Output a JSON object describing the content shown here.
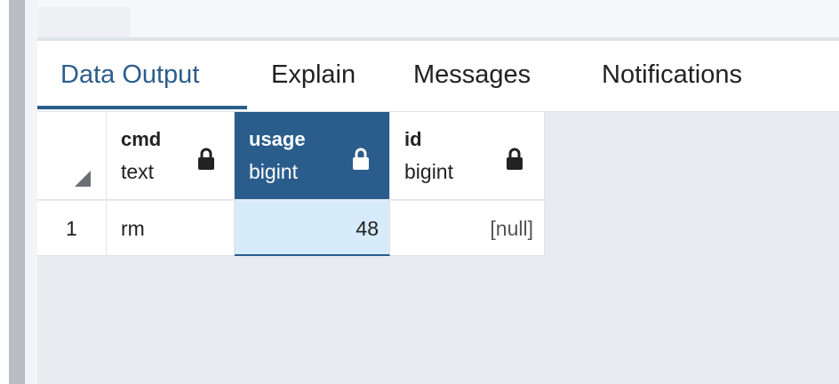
{
  "tabs": [
    {
      "label": "Data Output",
      "active": true
    },
    {
      "label": "Explain",
      "active": false
    },
    {
      "label": "Messages",
      "active": false
    },
    {
      "label": "Notifications",
      "active": false
    }
  ],
  "columns": [
    {
      "name": "cmd",
      "type": "text",
      "locked": true
    },
    {
      "name": "usage",
      "type": "bigint",
      "locked": true,
      "selected": true
    },
    {
      "name": "id",
      "type": "bigint",
      "locked": true
    }
  ],
  "rows": [
    {
      "row_number": "1",
      "cells": [
        "rm",
        "48",
        "[null]"
      ]
    }
  ],
  "colors": {
    "accent": "#2b5d8c",
    "selected_cell": "#d6ecfa",
    "background": "#e8ebf0"
  }
}
